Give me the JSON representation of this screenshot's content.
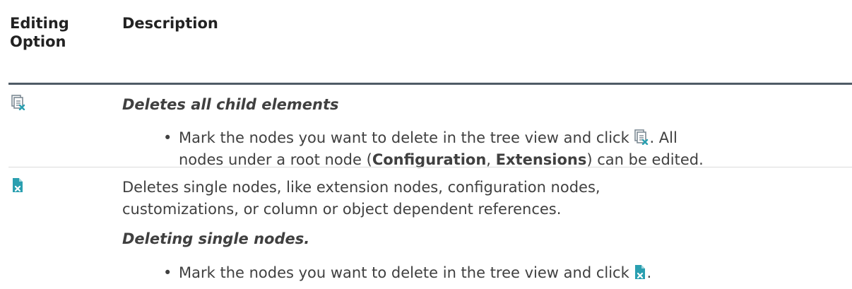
{
  "table": {
    "header": {
      "col1_line1": "Editing",
      "col1_line2": "Option",
      "col2": "Description"
    },
    "rows": [
      {
        "icon": "delete-all-children-icon",
        "heading": "Deletes all child elements",
        "bullet": {
          "before_icon": "Mark the nodes you want to delete in the tree view and click",
          "after_icon": ". All",
          "line2_start": "nodes under a root node (",
          "bold1": "Configuration",
          "sep": ", ",
          "bold2": "Extensions",
          "line2_end": ") can be edited."
        }
      },
      {
        "icon": "delete-single-node-icon",
        "description_line1": "Deletes single nodes, like extension nodes, configuration nodes,",
        "description_line2": "customizations, or column or object dependent references.",
        "heading": "Deleting single nodes.",
        "bullet": {
          "before_icon": "Mark the nodes you want to delete in the tree view and click",
          "after_icon": "."
        }
      }
    ]
  },
  "colors": {
    "text": "#404040",
    "header_text": "#222222",
    "header_rule": "#4f5b66",
    "row_rule": "#dcdcdc",
    "icon_teal": "#2a9fb0",
    "icon_grey": "#7d8a94"
  }
}
